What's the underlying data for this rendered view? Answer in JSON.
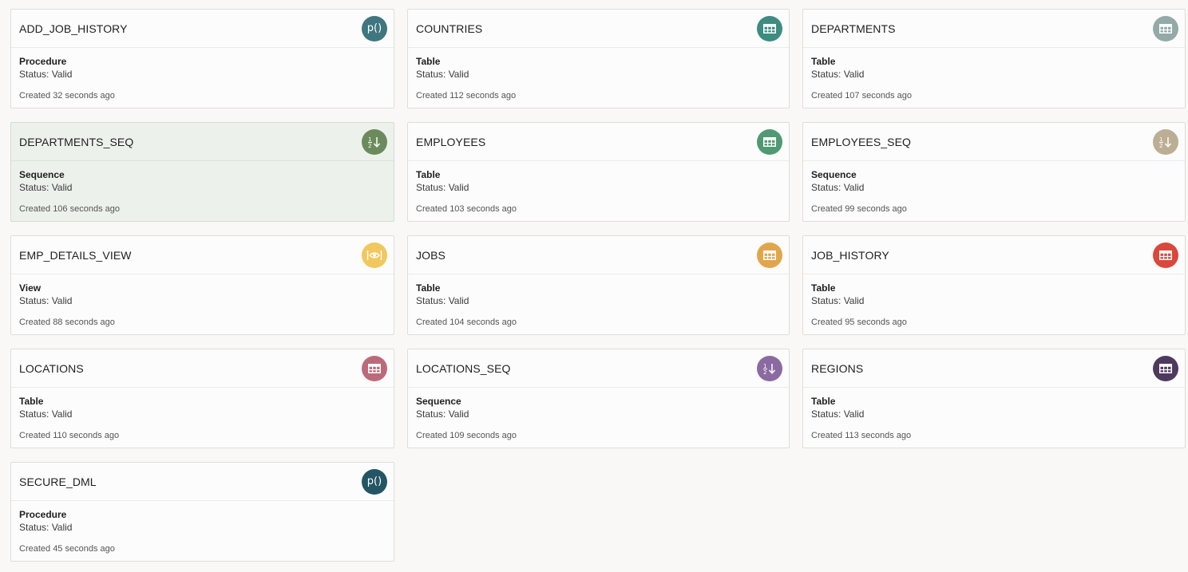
{
  "cards": [
    {
      "name": "ADD_JOB_HISTORY",
      "type": "Procedure",
      "status": "Status: Valid",
      "created": "Created 32 seconds ago",
      "icon": "procedure-icon",
      "color": "#3f7680"
    },
    {
      "name": "COUNTRIES",
      "type": "Table",
      "status": "Status: Valid",
      "created": "Created 112 seconds ago",
      "icon": "table-icon",
      "color": "#3d8c82"
    },
    {
      "name": "DEPARTMENTS",
      "type": "Table",
      "status": "Status: Valid",
      "created": "Created 107 seconds ago",
      "icon": "table-icon",
      "color": "#92aaa8"
    },
    {
      "name": "DEPARTMENTS_SEQ",
      "type": "Sequence",
      "status": "Status: Valid",
      "created": "Created 106 seconds ago",
      "icon": "sequence-icon",
      "color": "#6c8b5d",
      "selected": true
    },
    {
      "name": "EMPLOYEES",
      "type": "Table",
      "status": "Status: Valid",
      "created": "Created 103 seconds ago",
      "icon": "table-icon",
      "color": "#4f9a72"
    },
    {
      "name": "EMPLOYEES_SEQ",
      "type": "Sequence",
      "status": "Status: Valid",
      "created": "Created 99 seconds ago",
      "icon": "sequence-icon",
      "color": "#bcae95"
    },
    {
      "name": "EMP_DETAILS_VIEW",
      "type": "View",
      "status": "Status: Valid",
      "created": "Created 88 seconds ago",
      "icon": "view-icon",
      "color": "#f1c85e"
    },
    {
      "name": "JOBS",
      "type": "Table",
      "status": "Status: Valid",
      "created": "Created 104 seconds ago",
      "icon": "table-icon",
      "color": "#e1a64b"
    },
    {
      "name": "JOB_HISTORY",
      "type": "Table",
      "status": "Status: Valid",
      "created": "Created 95 seconds ago",
      "icon": "table-icon",
      "color": "#d9483b"
    },
    {
      "name": "LOCATIONS",
      "type": "Table",
      "status": "Status: Valid",
      "created": "Created 110 seconds ago",
      "icon": "table-icon",
      "color": "#bc6a79"
    },
    {
      "name": "LOCATIONS_SEQ",
      "type": "Sequence",
      "status": "Status: Valid",
      "created": "Created 109 seconds ago",
      "icon": "sequence-icon",
      "color": "#8a6aa0"
    },
    {
      "name": "REGIONS",
      "type": "Table",
      "status": "Status: Valid",
      "created": "Created 113 seconds ago",
      "icon": "table-icon",
      "color": "#4e3a5e"
    },
    {
      "name": "SECURE_DML",
      "type": "Procedure",
      "status": "Status: Valid",
      "created": "Created 45 seconds ago",
      "icon": "procedure-icon",
      "color": "#245564"
    }
  ],
  "icon_glyphs": {
    "procedure-icon": "p()"
  }
}
